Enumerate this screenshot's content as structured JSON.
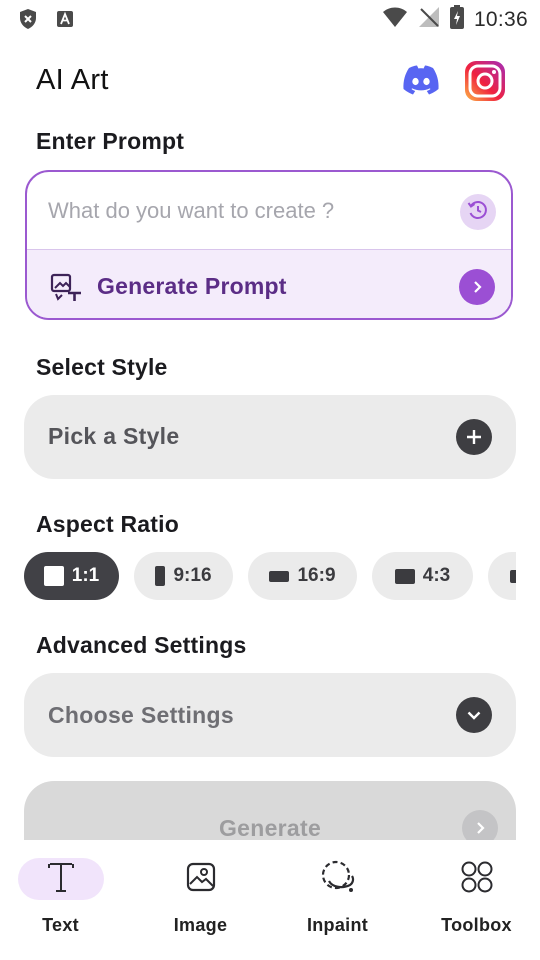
{
  "status_bar": {
    "time": "10:36",
    "left_icons": [
      "shield-x-icon",
      "font-a-icon"
    ],
    "right_icons": [
      "wifi-icon",
      "no-signal-icon",
      "battery-charging-icon"
    ]
  },
  "header": {
    "title": "AI Art",
    "social_icons": [
      "discord-icon",
      "instagram-icon"
    ]
  },
  "prompt_section": {
    "label": "Enter Prompt",
    "placeholder": "What do you want to create ?",
    "value": "",
    "history_icon": "history-icon",
    "generate_prompt_label": "Generate Prompt"
  },
  "style_section": {
    "label": "Select Style",
    "picker_label": "Pick a Style",
    "add_icon": "plus-icon"
  },
  "aspect_section": {
    "label": "Aspect Ratio",
    "options": [
      {
        "label": "1:1",
        "selected": true
      },
      {
        "label": "9:16",
        "selected": false
      },
      {
        "label": "16:9",
        "selected": false
      },
      {
        "label": "4:3",
        "selected": false
      },
      {
        "label": "",
        "selected": false
      }
    ]
  },
  "advanced_section": {
    "label": "Advanced Settings",
    "picker_label": "Choose Settings",
    "dropdown_icon": "chevron-down-icon"
  },
  "generate": {
    "label": "Generate",
    "enabled": false
  },
  "bottom_nav": {
    "items": [
      {
        "label": "Text",
        "icon": "text-icon",
        "active": true
      },
      {
        "label": "Image",
        "icon": "image-icon",
        "active": false
      },
      {
        "label": "Inpaint",
        "icon": "inpaint-icon",
        "active": false
      },
      {
        "label": "Toolbox",
        "icon": "toolbox-icon",
        "active": false
      }
    ]
  },
  "colors": {
    "accent": "#9b4fd4",
    "accent_light": "#f4ecfb",
    "dark_chip": "#414146",
    "surface": "#ebebeb"
  }
}
